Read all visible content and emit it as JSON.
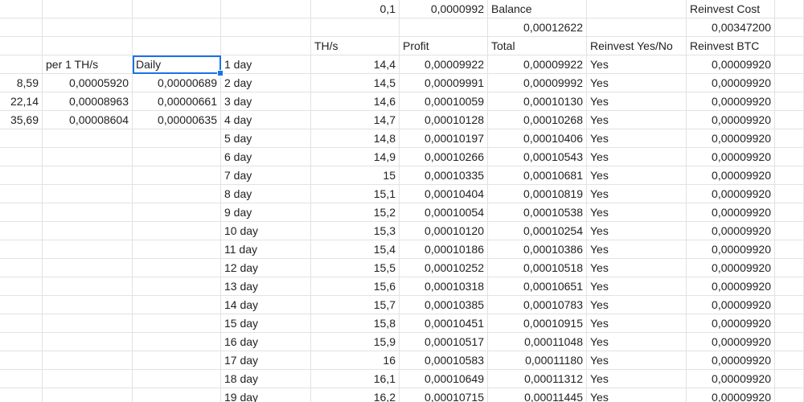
{
  "sheet": {
    "selected_cell": "C4",
    "rows": [
      [
        "",
        "",
        "",
        "",
        "0,1",
        "0,0000992",
        "Balance",
        "",
        "Reinvest Cost"
      ],
      [
        "",
        "",
        "",
        "",
        "",
        "",
        "0,00012622",
        "",
        "0,00347200"
      ],
      [
        "",
        "",
        "",
        "",
        "TH/s",
        "Profit",
        "Total",
        "Reinvest Yes/No",
        "Reinvest BTC"
      ],
      [
        "",
        "per 1 TH/s",
        "Daily",
        "1 day",
        "14,4",
        "0,00009922",
        "0,00009922",
        "Yes",
        "0,00009920"
      ],
      [
        "8,59",
        "0,00005920",
        "0,00000689",
        "2 day",
        "14,5",
        "0,00009991",
        "0,00009992",
        "Yes",
        "0,00009920"
      ],
      [
        "22,14",
        "0,00008963",
        "0,00000661",
        "3 day",
        "14,6",
        "0,00010059",
        "0,00010130",
        "Yes",
        "0,00009920"
      ],
      [
        "35,69",
        "0,00008604",
        "0,00000635",
        "4 day",
        "14,7",
        "0,00010128",
        "0,00010268",
        "Yes",
        "0,00009920"
      ],
      [
        "",
        "",
        "",
        "5 day",
        "14,8",
        "0,00010197",
        "0,00010406",
        "Yes",
        "0,00009920"
      ],
      [
        "",
        "",
        "",
        "6 day",
        "14,9",
        "0,00010266",
        "0,00010543",
        "Yes",
        "0,00009920"
      ],
      [
        "",
        "",
        "",
        "7 day",
        "15",
        "0,00010335",
        "0,00010681",
        "Yes",
        "0,00009920"
      ],
      [
        "",
        "",
        "",
        "8 day",
        "15,1",
        "0,00010404",
        "0,00010819",
        "Yes",
        "0,00009920"
      ],
      [
        "",
        "",
        "",
        "9 day",
        "15,2",
        "0,00010054",
        "0,00010538",
        "Yes",
        "0,00009920"
      ],
      [
        "",
        "",
        "",
        "10 day",
        "15,3",
        "0,00010120",
        "0,00010254",
        "Yes",
        "0,00009920"
      ],
      [
        "",
        "",
        "",
        "11 day",
        "15,4",
        "0,00010186",
        "0,00010386",
        "Yes",
        "0,00009920"
      ],
      [
        "",
        "",
        "",
        "12 day",
        "15,5",
        "0,00010252",
        "0,00010518",
        "Yes",
        "0,00009920"
      ],
      [
        "",
        "",
        "",
        "13 day",
        "15,6",
        "0,00010318",
        "0,00010651",
        "Yes",
        "0,00009920"
      ],
      [
        "",
        "",
        "",
        "14 day",
        "15,7",
        "0,00010385",
        "0,00010783",
        "Yes",
        "0,00009920"
      ],
      [
        "",
        "",
        "",
        "15 day",
        "15,8",
        "0,00010451",
        "0,00010915",
        "Yes",
        "0,00009920"
      ],
      [
        "",
        "",
        "",
        "16 day",
        "15,9",
        "0,00010517",
        "0,00011048",
        "Yes",
        "0,00009920"
      ],
      [
        "",
        "",
        "",
        "17 day",
        "16",
        "0,00010583",
        "0,00011180",
        "Yes",
        "0,00009920"
      ],
      [
        "",
        "",
        "",
        "18 day",
        "16,1",
        "0,00010649",
        "0,00011312",
        "Yes",
        "0,00009920"
      ],
      [
        "",
        "",
        "",
        "19 day",
        "16,2",
        "0,00010715",
        "0,00011445",
        "Yes",
        "0,00009920"
      ]
    ]
  }
}
